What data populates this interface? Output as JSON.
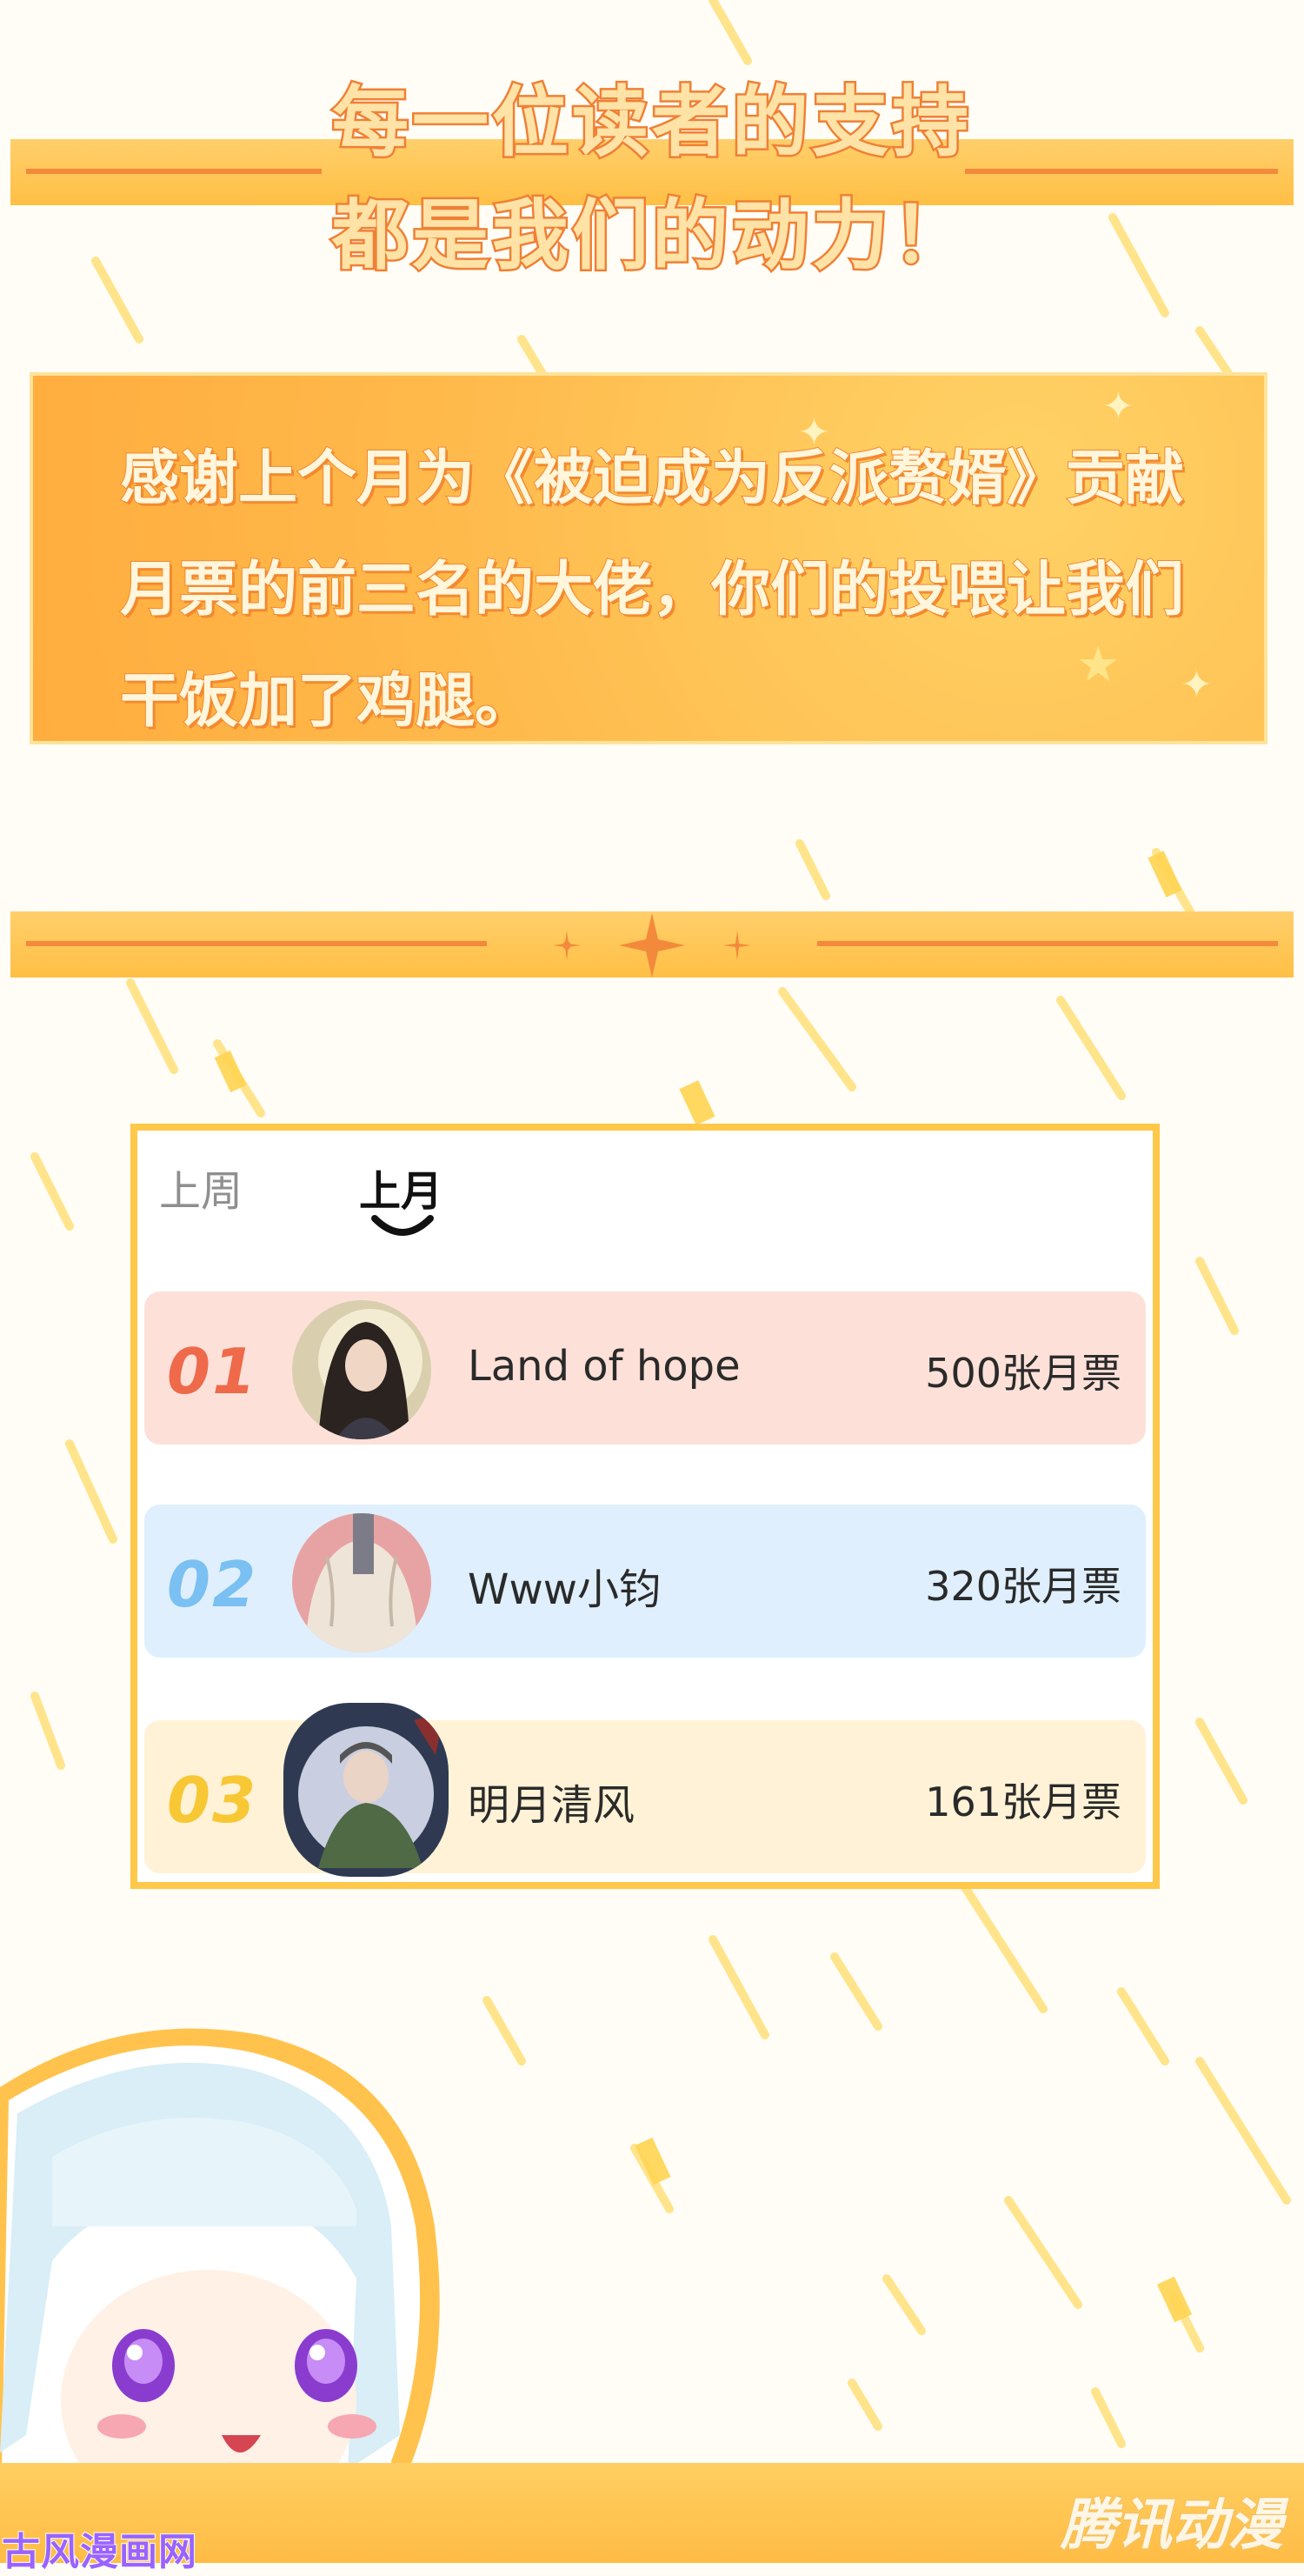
{
  "headline": {
    "line1": "每一位读者的支持",
    "line2": "都是我们的动力！"
  },
  "thanks_message": "感谢上个月为《被迫成为反派赘婿》贡献月票的前三名的大佬，你们的投喂让我们干饭加了鸡腿。",
  "leaderboard": {
    "tabs": [
      {
        "label": "上周",
        "active": false
      },
      {
        "label": "上月",
        "active": true
      }
    ],
    "rows": [
      {
        "rank": "01",
        "name": "Land of hope",
        "votes": "500张月票",
        "rank_color": "#ef6a4a"
      },
      {
        "rank": "02",
        "name": "Www小钧",
        "votes": "320张月票",
        "rank_color": "#7ac0f2"
      },
      {
        "rank": "03",
        "name": "明月清风",
        "votes": "161张月票",
        "rank_color": "#f8c734"
      }
    ]
  },
  "watermarks": {
    "left": "古风漫画网",
    "right": "腾讯动漫"
  },
  "colors": {
    "banner": "#ffc34d",
    "banner_line": "#f38a3b",
    "headline_stroke": "#f08035",
    "panel": "#ffb84a",
    "board_border": "#ffc849"
  }
}
